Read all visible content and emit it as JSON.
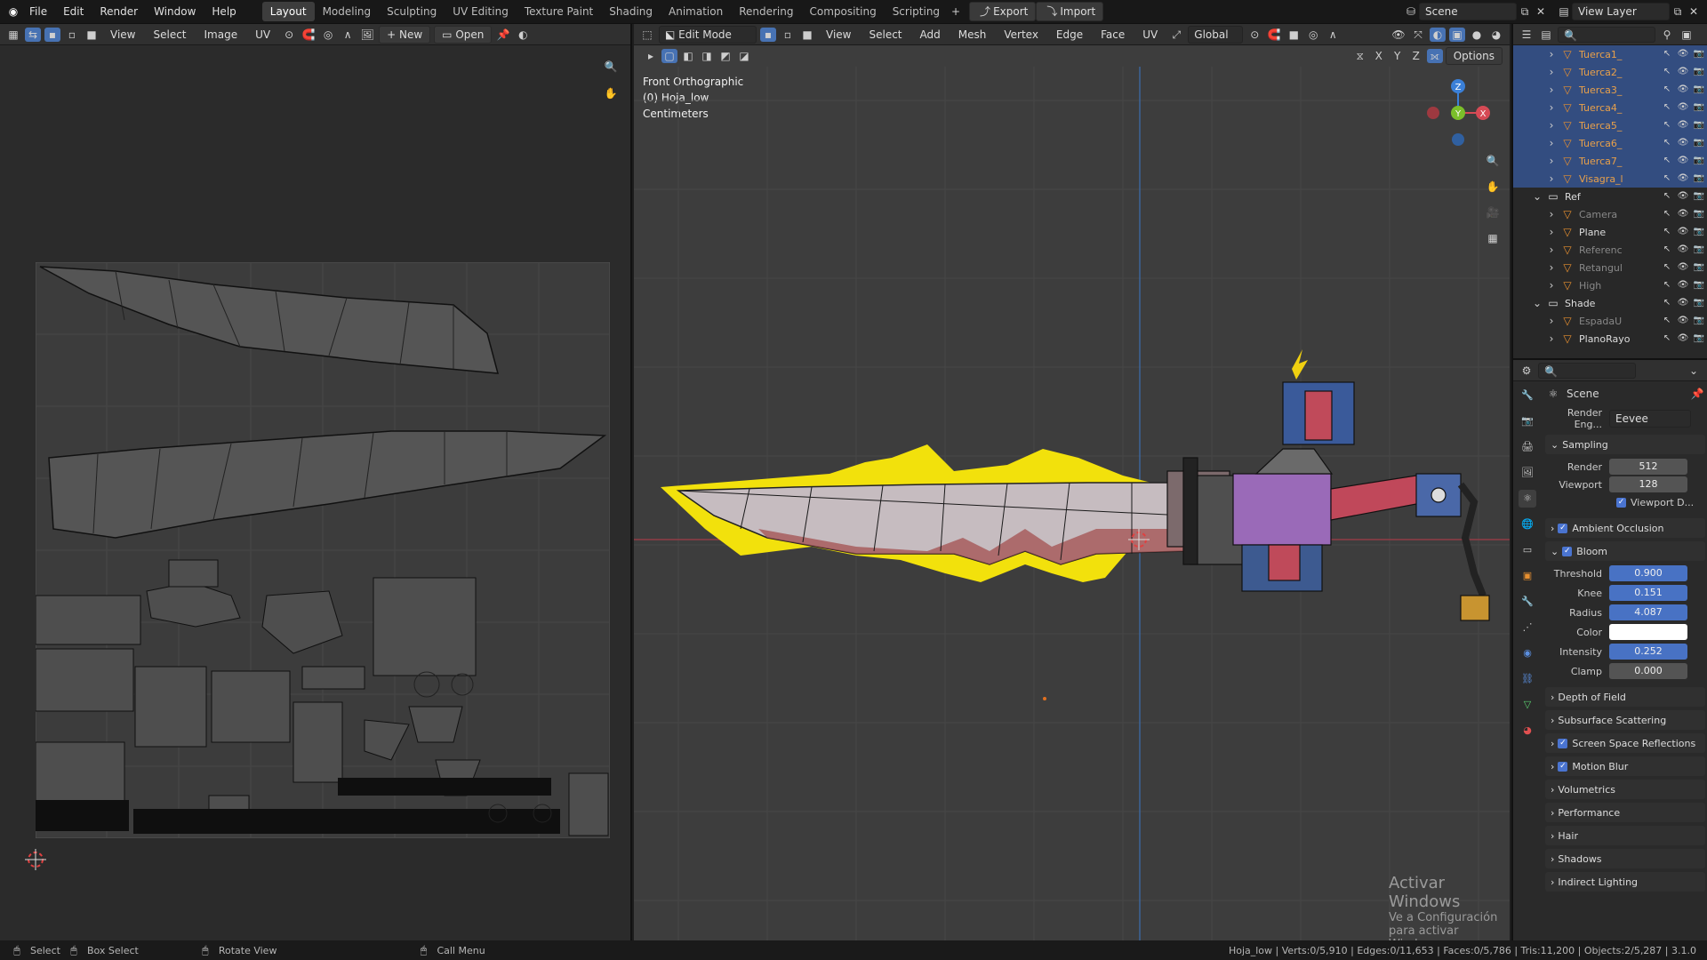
{
  "menus": [
    "File",
    "Edit",
    "Render",
    "Window",
    "Help"
  ],
  "workspaces": [
    "Layout",
    "Modeling",
    "Sculpting",
    "UV Editing",
    "Texture Paint",
    "Shading",
    "Animation",
    "Rendering",
    "Compositing",
    "Scripting"
  ],
  "active_workspace": "Layout",
  "top_buttons": {
    "export": "Export",
    "import": "Import",
    "scene": "Scene",
    "view_layer": "View Layer"
  },
  "uv_editor": {
    "menus": [
      "View",
      "Select",
      "Image",
      "UV"
    ],
    "new_label": "New",
    "open_label": "Open"
  },
  "viewport": {
    "mode": "Edit Mode",
    "menus": [
      "View",
      "Select",
      "Add",
      "Mesh",
      "Vertex",
      "Edge",
      "Face",
      "UV"
    ],
    "transform": "Global",
    "options_label": "Options",
    "axes_labels": [
      "X",
      "Y",
      "Z"
    ],
    "overlay_lines": [
      "Front Orthographic",
      "(0) Hoja_low",
      "Centimeters"
    ]
  },
  "outliner": {
    "rows": [
      {
        "name": "Tuerca1_",
        "kind": "object",
        "selected": true
      },
      {
        "name": "Tuerca2_",
        "kind": "object",
        "selected": true
      },
      {
        "name": "Tuerca3_",
        "kind": "object",
        "selected": true
      },
      {
        "name": "Tuerca4_",
        "kind": "object",
        "selected": true
      },
      {
        "name": "Tuerca5_",
        "kind": "object",
        "selected": true
      },
      {
        "name": "Tuerca6_",
        "kind": "object",
        "selected": true
      },
      {
        "name": "Tuerca7_",
        "kind": "object",
        "selected": true
      },
      {
        "name": "Visagra_l",
        "kind": "object",
        "selected": true
      },
      {
        "name": "Ref",
        "kind": "collection",
        "selected": false
      },
      {
        "name": "Camera",
        "kind": "dim",
        "selected": false
      },
      {
        "name": "Plane",
        "kind": "plain",
        "selected": false
      },
      {
        "name": "Referenc",
        "kind": "dim",
        "selected": false
      },
      {
        "name": "Retangul",
        "kind": "dim",
        "selected": false
      },
      {
        "name": "High",
        "kind": "dim",
        "selected": false
      },
      {
        "name": "Shade",
        "kind": "collection",
        "selected": false
      },
      {
        "name": "EspadaU",
        "kind": "dim",
        "selected": false
      },
      {
        "name": "PlanoRayo",
        "kind": "plain",
        "selected": false
      }
    ]
  },
  "properties": {
    "context": "Scene",
    "render_engine_label": "Render Eng...",
    "render_engine": "Eevee",
    "sampling": {
      "label": "Sampling",
      "render_label": "Render",
      "render": "512",
      "viewport_label": "Viewport",
      "viewport": "128",
      "denoise_label": "Viewport D..."
    },
    "ambient_occlusion": "Ambient Occlusion",
    "bloom": {
      "label": "Bloom",
      "threshold_label": "Threshold",
      "threshold": "0.900",
      "knee_label": "Knee",
      "knee": "0.151",
      "radius_label": "Radius",
      "radius": "4.087",
      "color_label": "Color",
      "intensity_label": "Intensity",
      "intensity": "0.252",
      "clamp_label": "Clamp",
      "clamp": "0.000"
    },
    "sections": [
      "Depth of Field",
      "Subsurface Scattering",
      "Screen Space Reflections",
      "Motion Blur",
      "Volumetrics",
      "Performance",
      "Hair",
      "Shadows",
      "Indirect Lighting"
    ]
  },
  "watermark": {
    "line1": "Activar Windows",
    "line2": "Ve a Configuración para activar Windows."
  },
  "statusbar": {
    "items": [
      "Select",
      "Box Select",
      "Rotate View",
      "Call Menu"
    ],
    "stats": "Hoja_low | Verts:0/5,910 | Edges:0/11,653 | Faces:0/5,786 | Tris:11,200 | Objects:2/5,287 | 3.1.0"
  }
}
